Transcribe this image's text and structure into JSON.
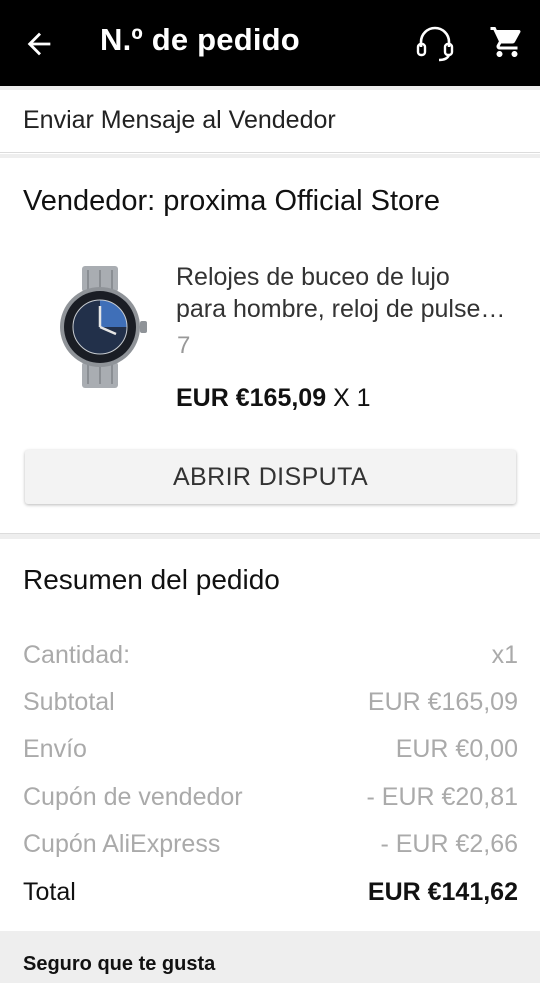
{
  "header": {
    "title": "N.º de pedido",
    "back_icon": "arrow-left-icon",
    "support_icon": "headset-icon",
    "cart_icon": "cart-icon"
  },
  "message_seller": {
    "label": "Enviar Mensaje al Vendedor"
  },
  "seller": {
    "name": "Vendedor: proxima Official Store",
    "product": {
      "image_icon": "wristwatch-image",
      "title_line1": "Relojes de buceo de lujo",
      "title_line2": "para hombre, reloj de pulse…",
      "variant": "7",
      "price": "EUR €165,09",
      "quantity": "X 1"
    },
    "dispute_button": "ABRIR DISPUTA"
  },
  "summary": {
    "title": "Resumen del pedido",
    "rows": [
      {
        "label": "Cantidad:",
        "value": "x1"
      },
      {
        "label": "Subtotal",
        "value": "EUR €165,09"
      },
      {
        "label": "Envío",
        "value": "EUR €0,00"
      },
      {
        "label": "Cupón de vendedor",
        "value": "- EUR €20,81"
      },
      {
        "label": "Cupón AliExpress",
        "value": "- EUR €2,66"
      }
    ],
    "total": {
      "label": "Total",
      "value": "EUR €141,62"
    }
  },
  "recommendations": {
    "title": "Seguro que te gusta"
  },
  "colors": {
    "header_bg": "#000000",
    "page_bg": "#eeeeee",
    "muted_text": "#aaaaaa",
    "button_bg": "#f3f3f3"
  }
}
